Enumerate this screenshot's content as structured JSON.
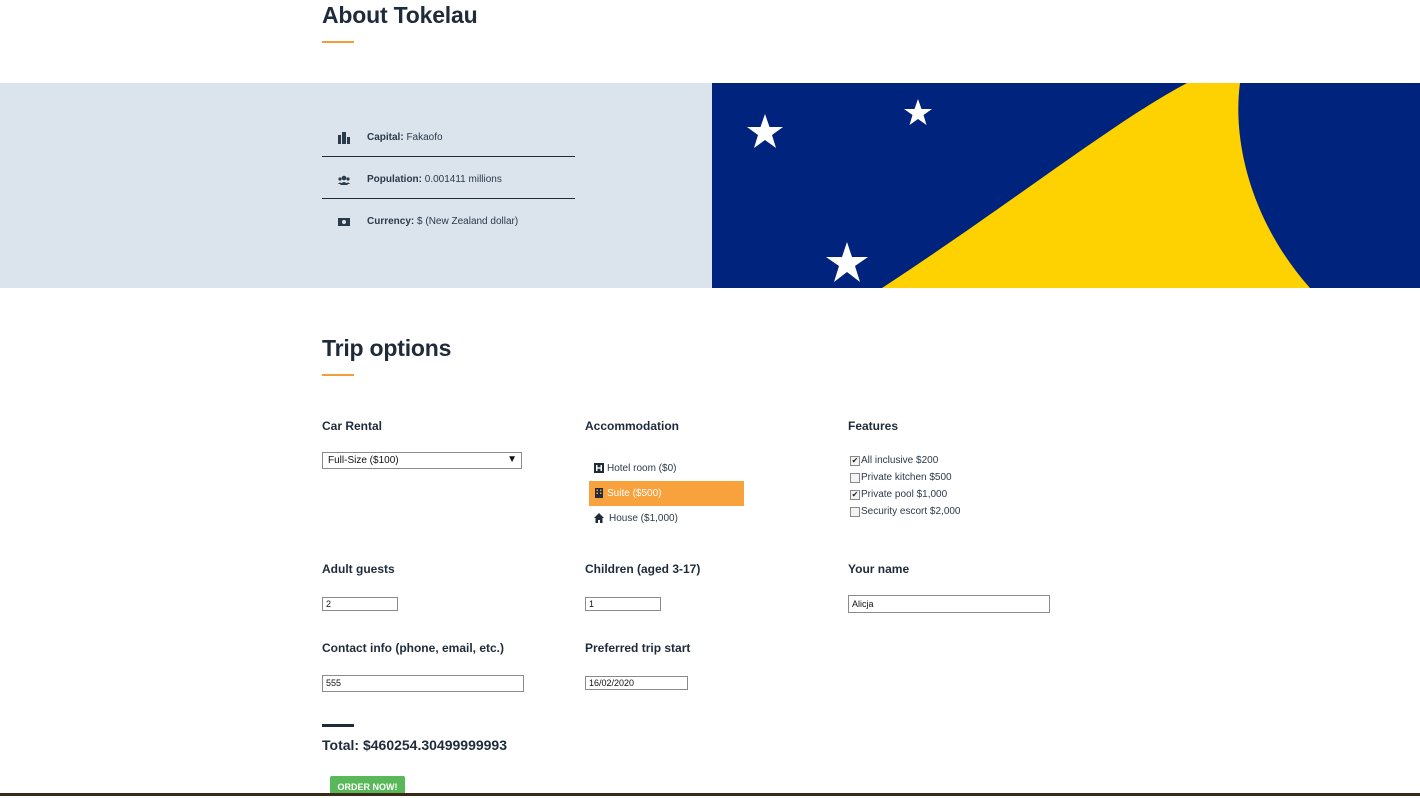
{
  "about": {
    "title": "About Tokelau",
    "capital_label": "Capital:",
    "capital_value": "Fakaofo",
    "population_label": "Population:",
    "population_value": "0.001411 millions",
    "currency_label": "Currency:",
    "currency_value": "$ (New Zealand dollar)",
    "icons": [
      "city-icon",
      "users-icon",
      "money-icon"
    ],
    "flag_colors": {
      "blue": "#00247d",
      "yellow": "#fed100",
      "white": "#ffffff"
    }
  },
  "trip": {
    "title": "Trip options",
    "car_rental": {
      "label": "Car Rental",
      "selected": "Full-Size ($100)"
    },
    "accommodation": {
      "label": "Accommodation",
      "items": [
        {
          "label": "Hotel room ($0)",
          "icon": "hotel-icon",
          "selected": false
        },
        {
          "label": "Suite ($500)",
          "icon": "building-icon",
          "selected": true
        },
        {
          "label": "House ($1,000)",
          "icon": "home-icon",
          "selected": false
        }
      ]
    },
    "features": {
      "label": "Features",
      "items": [
        {
          "label": "All inclusive $200",
          "checked": true
        },
        {
          "label": "Private kitchen $500",
          "checked": false
        },
        {
          "label": "Private pool $1,000",
          "checked": true
        },
        {
          "label": "Security escort $2,000",
          "checked": false
        }
      ]
    },
    "adult_guests": {
      "label": "Adult guests",
      "value": "2"
    },
    "children": {
      "label": "Children (aged 3-17)",
      "value": "1"
    },
    "your_name": {
      "label": "Your name",
      "value": "Alicja"
    },
    "contact": {
      "label": "Contact info (phone, email, etc.)",
      "value": "555"
    },
    "trip_start": {
      "label": "Preferred trip start",
      "value": "16/02/2020"
    },
    "total": "Total: $460254.30499999993",
    "order_button": "ORDER NOW!",
    "accent_color": "#f8a23e",
    "button_color": "#58b85a"
  }
}
